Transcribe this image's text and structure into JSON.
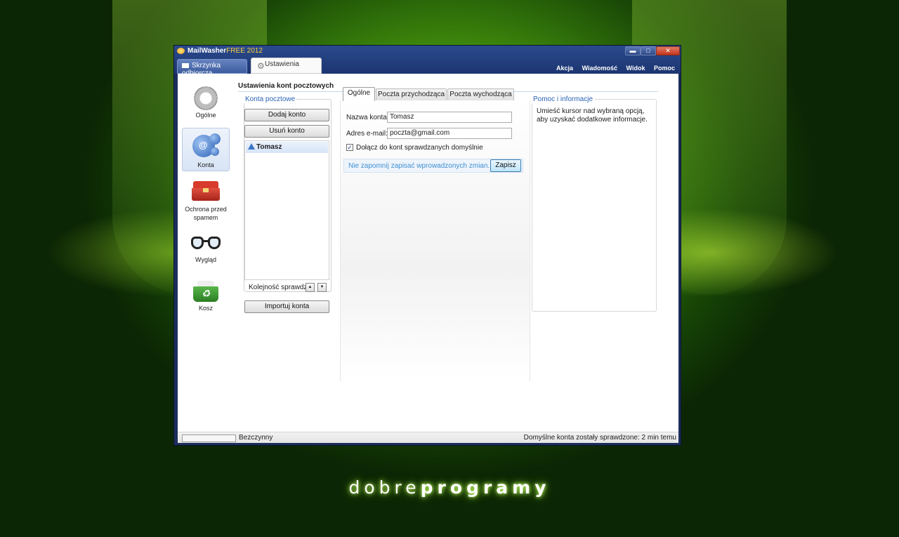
{
  "window": {
    "app_name": "MailWasher",
    "app_edition": "FREE 2012",
    "tabs": [
      {
        "label": "Skrzynka odbiorcza"
      },
      {
        "label": "Ustawienia"
      }
    ],
    "controls": {
      "minimize": "▬",
      "maximize": "□",
      "close": "✕"
    },
    "menu": [
      "Akcja",
      "Wiadomość",
      "Widok",
      "Pomoc"
    ]
  },
  "sidebar": {
    "items": [
      {
        "label": "Ogólne",
        "icon": "gear-icon"
      },
      {
        "label": "Konta",
        "icon": "accounts-icon",
        "active": true
      },
      {
        "label": "Ochrona przed spamem",
        "icon": "toolbox-icon"
      },
      {
        "label": "Wygląd",
        "icon": "glasses-icon"
      },
      {
        "label": "Kosz",
        "icon": "recycle-bin-icon"
      }
    ]
  },
  "main": {
    "title": "Ustawienia kont pocztowych",
    "accounts_group": {
      "legend": "Konta pocztowe",
      "add_button": "Dodaj konto",
      "remove_button": "Usuń konto",
      "accounts": [
        "Tomasz"
      ],
      "order_label": "Kolejność sprawdz.",
      "import_button": "Importuj konta"
    },
    "subtabs": [
      "Ogólne",
      "Poczta przychodząca",
      "Poczta wychodząca"
    ],
    "form": {
      "name_label": "Nazwa konta:",
      "name_value": "Tomasz",
      "email_label": "Adres e-mail:",
      "email_value": "poczta@gmail.com",
      "checkbox_label": "Dołącz do kont sprawdzanych domyślnie",
      "checkbox_checked": true,
      "notice": "Nie zapomnij zapisać wprowadzonych zmian.",
      "save_button": "Zapisz"
    },
    "help": {
      "legend": "Pomoc i informacje",
      "text": "Umieść kursor nad wybraną opcją, aby uzyskać dodatkowe informacje."
    }
  },
  "status": {
    "state": "Bezczynny",
    "message": "Domyślne konta zostały sprawdzone: 2 min temu"
  },
  "brand": {
    "part1": "dobre",
    "part2": "programy"
  },
  "colors": {
    "accent": "#2a62b7",
    "title_bar": "#2a4a8c",
    "background": "#3f8a0c"
  }
}
